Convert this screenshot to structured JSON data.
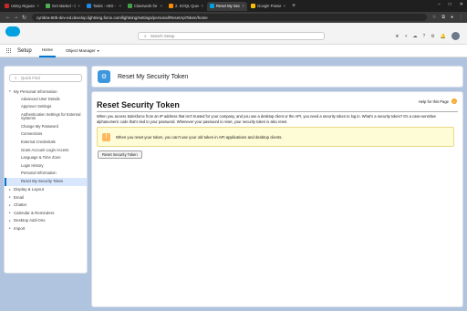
{
  "browser": {
    "tabs": [
      {
        "label": "Using Akguard (...",
        "color": "#c62828"
      },
      {
        "label": "Get started - Cy...",
        "color": "#4caf50"
      },
      {
        "label": "Tasks - AIID - 20...",
        "color": "#1e88e5"
      },
      {
        "label": "Classwork for 20...",
        "color": "#43a047"
      },
      {
        "label": "2. SOQL Queries...",
        "color": "#fb8c00"
      },
      {
        "label": "Reset My Securit...",
        "color": "#00a1e0"
      },
      {
        "label": "Google Password...",
        "color": "#fbbc05"
      }
    ],
    "active_tab_index": 5,
    "url": "cymbra-60b-dev-ed.develop.lightning.force.com/lightning/settings/personal/ResetApiToken/home"
  },
  "header": {
    "search_placeholder": "Search Setup"
  },
  "appbar": {
    "app_name": "Setup",
    "tabs": [
      {
        "label": "Home",
        "active": true
      },
      {
        "label": "Object Manager",
        "active": false
      }
    ]
  },
  "sidebar": {
    "quick_find_placeholder": "Quick Find",
    "group_label": "My Personal Information",
    "subitems": [
      "Advanced User Details",
      "Approver Settings",
      "Authentication Settings for External Systems",
      "Change My Password",
      "Connections",
      "External Credentials",
      "Grant Account Login Access",
      "Language & Time Zone",
      "Login History",
      "Personal Information",
      "Reset My Security Token"
    ],
    "selected_subitem_index": 10,
    "collapsed_groups": [
      "Display & Layout",
      "Email",
      "Chatter",
      "Calendar & Reminders",
      "Desktop Add-Ons",
      "Import"
    ]
  },
  "page": {
    "header_title": "Reset My Security Token",
    "title": "Reset Security Token",
    "help_link": "Help for this Page",
    "description": "When you access Salesforce from an IP address that isn't trusted for your company, and you use a desktop client or the API, you need a security token to log in. What's a security token? It's a case-sensitive alphanumeric code that's tied to your password. Whenever your password is reset, your security token is also reset.",
    "warning": "When you reset your token, you can't use your old token in API applications and desktop clients.",
    "button_label": "Reset Security Token"
  }
}
